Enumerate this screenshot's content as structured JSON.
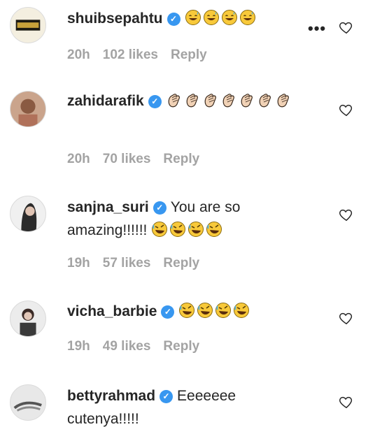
{
  "comments": [
    {
      "username": "shuibsepahtu",
      "verified": true,
      "text": "",
      "emoji": [
        "grin-sweat-emoji",
        "grin-sweat-emoji",
        "grin-sweat-emoji",
        "grin-sweat-emoji"
      ],
      "time": "20h",
      "likes": "102 likes",
      "reply": "Reply",
      "more": "•••"
    },
    {
      "username": "zahidarafik",
      "verified": true,
      "text": "",
      "emoji": [
        "clap-emoji",
        "clap-emoji",
        "clap-emoji",
        "clap-emoji",
        "clap-emoji",
        "clap-emoji",
        "clap-emoji"
      ],
      "time": "20h",
      "likes": "70 likes",
      "reply": "Reply"
    },
    {
      "username": "sanjna_suri",
      "verified": true,
      "text": "You are so amazing!!!!!!",
      "emoji": [
        "rofl-emoji",
        "rofl-emoji",
        "rofl-emoji",
        "rofl-emoji"
      ],
      "time": "19h",
      "likes": "57 likes",
      "reply": "Reply"
    },
    {
      "username": "vicha_barbie",
      "verified": true,
      "text": "",
      "emoji": [
        "rofl-emoji",
        "rofl-emoji",
        "rofl-emoji",
        "rofl-emoji"
      ],
      "time": "19h",
      "likes": "49 likes",
      "reply": "Reply"
    },
    {
      "username": "bettyrahmad",
      "verified": true,
      "text": "Eeeeeee cutenya!!!!!",
      "emoji": [],
      "time": "",
      "likes": "",
      "reply": ""
    }
  ],
  "colors": {
    "verified": "#3897f0",
    "meta": "#a3a3a3",
    "text": "#262626"
  }
}
